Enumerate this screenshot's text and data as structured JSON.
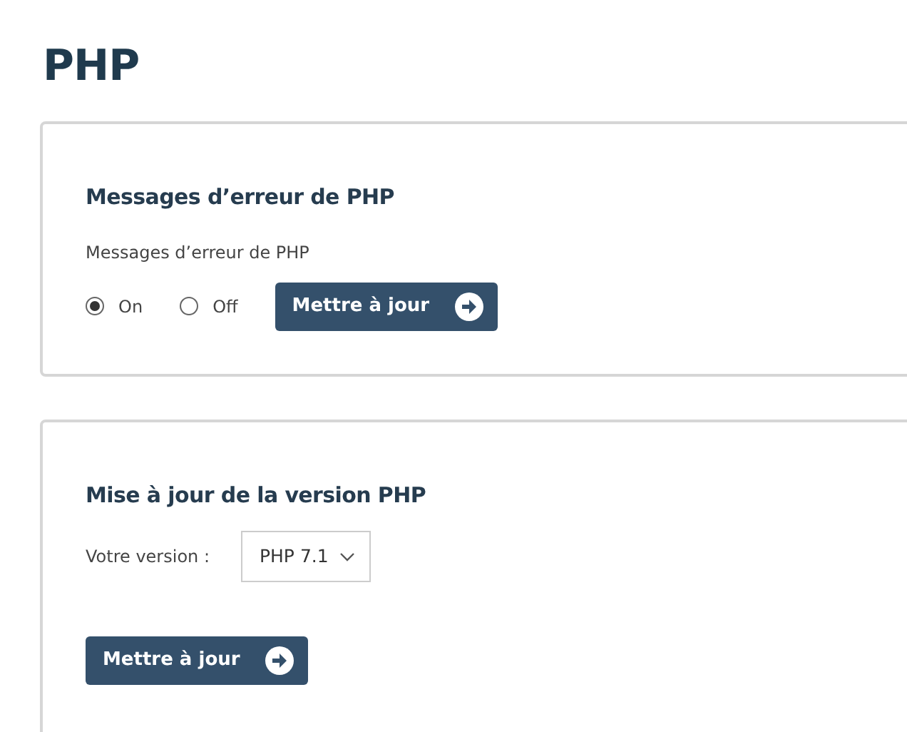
{
  "title": "PHP",
  "error_section": {
    "heading": "Messages d’erreur de PHP",
    "label": "Messages d’erreur de PHP",
    "options": [
      {
        "label": "On",
        "selected": true
      },
      {
        "label": "Off",
        "selected": false
      }
    ],
    "button": "Mettre à jour"
  },
  "version_section": {
    "heading": "Mise à jour de la version PHP",
    "label": "Votre version :",
    "value": "PHP 7.1",
    "button": "Mettre à jour"
  }
}
